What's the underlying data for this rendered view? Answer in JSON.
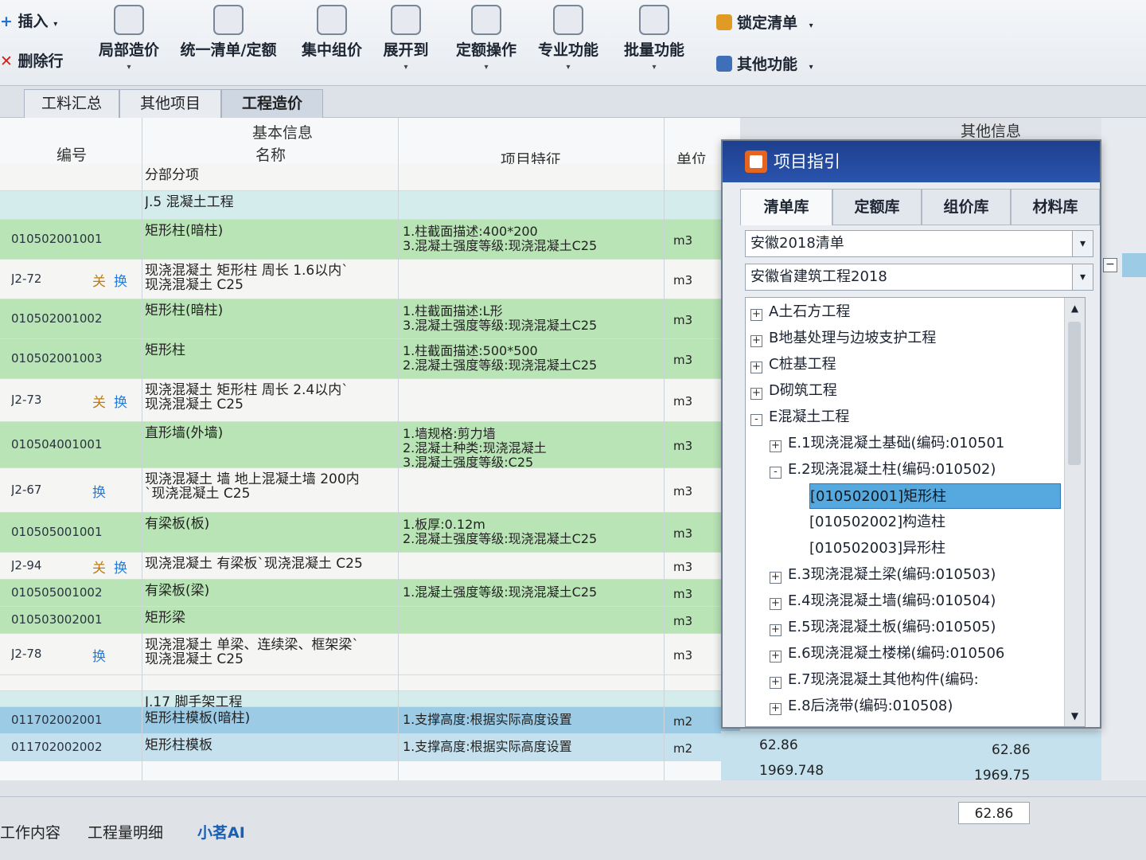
{
  "toolbar": {
    "insert": "插入",
    "delete_row": "删除行",
    "buttons": [
      {
        "label": "局部造价",
        "icon": "pie-chart-icon"
      },
      {
        "label": "统一清单/定额",
        "icon": "yen-doc-icon"
      },
      {
        "label": "集中组价",
        "icon": "grid-build-icon"
      },
      {
        "label": "展开到",
        "icon": "tree-expand-icon"
      },
      {
        "label": "定额操作",
        "icon": "gear-doc-icon"
      },
      {
        "label": "专业功能",
        "icon": "toolbox-icon"
      },
      {
        "label": "批量功能",
        "icon": "batch-gear-icon"
      }
    ],
    "lock_list": "锁定清单",
    "other_functions": "其他功能"
  },
  "tabs": [
    "工料汇总",
    "其他项目",
    "工程造价"
  ],
  "grid": {
    "group_header": "基本信息",
    "other_info_header": "其他信息",
    "columns": {
      "code": "编号",
      "name": "名称",
      "feature": "项目特征",
      "unit": "单位"
    },
    "rows": [
      {
        "type": "white",
        "code": "",
        "name": [
          "分部分项"
        ],
        "feature": [],
        "unit": ""
      },
      {
        "type": "cyan",
        "code": "",
        "name": [
          "J.5 混凝土工程"
        ],
        "feature": [],
        "unit": ""
      },
      {
        "type": "green",
        "code": "010502001001",
        "name": [
          "矩形柱(暗柱)"
        ],
        "feature": [
          "1.柱截面描述:400*200",
          "3.混凝土强度等级:现浇混凝土C25"
        ],
        "unit": "m3"
      },
      {
        "type": "white",
        "code": "J2-72",
        "tags": [
          "关",
          "换"
        ],
        "name": [
          "现浇混凝土 矩形柱 周长 1.6以内`",
          "现浇混凝土 C25"
        ],
        "feature": [],
        "unit": "m3"
      },
      {
        "type": "green",
        "code": "010502001002",
        "name": [
          "矩形柱(暗柱)"
        ],
        "feature": [
          "1.柱截面描述:L形",
          "3.混凝土强度等级:现浇混凝土C25"
        ],
        "unit": "m3"
      },
      {
        "type": "green",
        "code": "010502001003",
        "name": [
          "矩形柱"
        ],
        "feature": [
          "1.柱截面描述:500*500",
          "2.混凝土强度等级:现浇混凝土C25"
        ],
        "unit": "m3"
      },
      {
        "type": "white",
        "code": "J2-73",
        "tags": [
          "关",
          "换"
        ],
        "name": [
          "现浇混凝土 矩形柱 周长 2.4以内`",
          "现浇混凝土 C25"
        ],
        "feature": [],
        "unit": "m3"
      },
      {
        "type": "green",
        "code": "010504001001",
        "name": [
          "直形墙(外墙)"
        ],
        "feature": [
          "1.墙规格:剪力墙",
          "2.混凝土种类:现浇混凝土",
          "3.混凝土强度等级:C25"
        ],
        "unit": "m3"
      },
      {
        "type": "white",
        "code": "J2-67",
        "tags": [
          "换"
        ],
        "name": [
          "现浇混凝土 墙 地上混凝土墙 200内",
          "`现浇混凝土 C25"
        ],
        "feature": [],
        "unit": "m3"
      },
      {
        "type": "green",
        "code": "010505001001",
        "name": [
          "有梁板(板)"
        ],
        "feature": [
          "1.板厚:0.12m",
          "2.混凝土强度等级:现浇混凝土C25"
        ],
        "unit": "m3"
      },
      {
        "type": "white",
        "code": "J2-94",
        "tags": [
          "关",
          "换"
        ],
        "name": [
          "现浇混凝土 有梁板`现浇混凝土 C25"
        ],
        "feature": [],
        "unit": "m3"
      },
      {
        "type": "green",
        "code": "010505001002",
        "name": [
          "有梁板(梁)"
        ],
        "feature": [
          "1.混凝土强度等级:现浇混凝土C25"
        ],
        "unit": "m3"
      },
      {
        "type": "green",
        "code": "010503002001",
        "name": [
          "矩形梁"
        ],
        "feature": [],
        "unit": "m3"
      },
      {
        "type": "white",
        "code": "J2-78",
        "tags": [
          "换"
        ],
        "name": [
          "现浇混凝土 单梁、连续梁、框架梁`",
          "现浇混凝土 C25"
        ],
        "feature": [],
        "unit": "m3"
      },
      {
        "type": "white",
        "code": "",
        "name": [],
        "feature": [],
        "unit": ""
      },
      {
        "type": "cyan",
        "code": "",
        "name": [
          "J.17 脚手架工程"
        ],
        "feature": [],
        "unit": ""
      },
      {
        "type": "blue",
        "code": "011702002001",
        "name": [
          "矩形柱模板(暗柱)"
        ],
        "feature": [
          "1.支撑高度:根据实际高度设置"
        ],
        "unit": "m2"
      },
      {
        "type": "lblue",
        "code": "011702002002",
        "name": [
          "矩形柱模板"
        ],
        "feature": [
          "1.支撑高度:根据实际高度设置"
        ],
        "unit": "m2"
      }
    ],
    "other_values": [
      {
        "a": "62.86",
        "b": "62.86"
      },
      {
        "a": "1969.748",
        "b": "1969.75"
      }
    ],
    "summary_value": "62.86"
  },
  "dialog": {
    "title": "项目指引",
    "tabs": [
      "清单库",
      "定额库",
      "组价库",
      "材料库"
    ],
    "list_select": "安徽2018清单",
    "quota_select": "安徽省建筑工程2018",
    "tree": [
      {
        "box": "+",
        "label": "A土石方工程",
        "level": 0
      },
      {
        "box": "+",
        "label": "B地基处理与边坡支护工程",
        "level": 0
      },
      {
        "box": "+",
        "label": "C桩基工程",
        "level": 0
      },
      {
        "box": "+",
        "label": "D砌筑工程",
        "level": 0
      },
      {
        "box": "-",
        "label": "E混凝土工程",
        "level": 0
      },
      {
        "box": "+",
        "label": "E.1现浇混凝土基础(编码:010501",
        "level": 1
      },
      {
        "box": "-",
        "label": "E.2现浇混凝土柱(编码:010502)",
        "level": 1
      },
      {
        "box": "",
        "label": "[010502001]矩形柱",
        "level": 2,
        "selected": true
      },
      {
        "box": "",
        "label": "[010502002]构造柱",
        "level": 2
      },
      {
        "box": "",
        "label": "[010502003]异形柱",
        "level": 2
      },
      {
        "box": "+",
        "label": "E.3现浇混凝土梁(编码:010503)",
        "level": 1
      },
      {
        "box": "+",
        "label": "E.4现浇混凝土墙(编码:010504)",
        "level": 1
      },
      {
        "box": "+",
        "label": "E.5现浇混凝土板(编码:010505)",
        "level": 1
      },
      {
        "box": "+",
        "label": "E.6现浇混凝土楼梯(编码:010506",
        "level": 1
      },
      {
        "box": "+",
        "label": "E.7现浇混凝土其他构件(编码:",
        "level": 1
      },
      {
        "box": "+",
        "label": "E.8后浇带(编码:010508)",
        "level": 1
      }
    ]
  },
  "footer": {
    "tabs": [
      "工作内容",
      "工程量明细",
      "小茗AI"
    ]
  },
  "colors": {
    "green_row": "#b9e4b6",
    "selected": "#55a9df",
    "title_bar": "#1e3f8e",
    "accent_link": "#1a5fb4"
  }
}
